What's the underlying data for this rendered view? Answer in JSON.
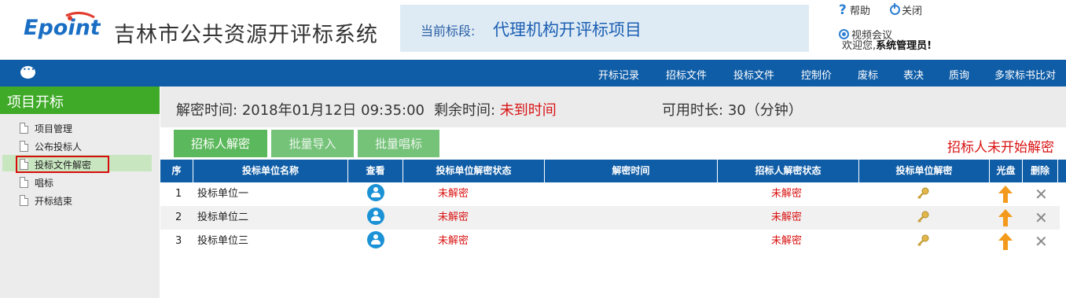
{
  "header": {
    "logo_text": "Epoint",
    "system_title": "吉林市公共资源开评标系统",
    "bid_prefix": "当前标段:",
    "bid_name": "代理机构开评标项目",
    "help_label": "帮助",
    "close_label": "关闭",
    "video_label": "视频会议",
    "welcome_prefix": "欢迎您,",
    "welcome_user": "系统管理员!"
  },
  "nav": {
    "items": [
      "开标记录",
      "招标文件",
      "投标文件",
      "控制价",
      "废标",
      "表决",
      "质询",
      "多家标书比对"
    ]
  },
  "sidebar": {
    "title": "项目开标",
    "items": [
      "项目管理",
      "公布投标人",
      "投标文件解密",
      "唱标",
      "开标结束"
    ],
    "active_index": 2
  },
  "info": {
    "decrypt_time_label": "解密时间:",
    "decrypt_time_value": "2018年01月12日 09:35:00",
    "remaining_label": "剩余时间:",
    "remaining_value": "未到时间",
    "available_label": "可用时长:",
    "available_value": "30（分钟）"
  },
  "buttons": {
    "tenderer_decrypt": "招标人解密",
    "batch_import": "批量导入",
    "batch_sing": "批量唱标"
  },
  "status_right": "招标人未开始解密",
  "table": {
    "headers": [
      "序",
      "投标单位名称",
      "查看",
      "投标单位解密状态",
      "解密时间",
      "招标人解密状态",
      "投标单位解密",
      "光盘",
      "删除"
    ],
    "rows": [
      {
        "index": "1",
        "name": "投标单位一",
        "bidder_status": "未解密",
        "decrypt_time": "",
        "tenderer_status": "未解密"
      },
      {
        "index": "2",
        "name": "投标单位二",
        "bidder_status": "未解密",
        "decrypt_time": "",
        "tenderer_status": "未解密"
      },
      {
        "index": "3",
        "name": "投标单位三",
        "bidder_status": "未解密",
        "decrypt_time": "",
        "tenderer_status": "未解密"
      }
    ]
  },
  "colors": {
    "nav_blue": "#0f5da7",
    "green": "#3faa28",
    "button_green": "#5cb85c",
    "alert_red": "#d91313",
    "icon_blue": "#1c92d6",
    "arrow_orange": "#f39a1c"
  },
  "icons": [
    "help-icon",
    "power-icon",
    "video-icon",
    "chat-icon",
    "document-icon",
    "user-icon",
    "key-icon",
    "upload-arrow-icon",
    "close-x-icon"
  ]
}
